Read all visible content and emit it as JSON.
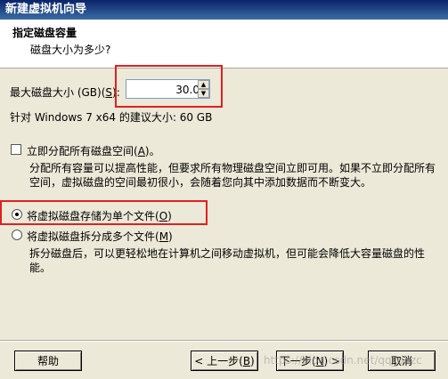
{
  "window": {
    "title": "新建虚拟机向导"
  },
  "header": {
    "title": "指定磁盘容量",
    "subtitle": "磁盘大小为多少?"
  },
  "disk_size": {
    "label_prefix": "最大磁盘大小 (GB)(",
    "label_hotkey": "S",
    "label_suffix": "):",
    "value": "30.0",
    "recommend": "针对 Windows 7 x64 的建议大小: 60 GB"
  },
  "allocate": {
    "label_prefix": "立即分配所有磁盘空间(",
    "label_hotkey": "A",
    "label_suffix": ")。",
    "checked": false,
    "desc_line1": "分配所有容量可以提高性能，但要求所有物理磁盘空间立即可用。如果不立即分配所有",
    "desc_line2": "空间，虚拟磁盘的空间最初很小，会随着您向其中添加数据而不断变大。"
  },
  "single_file": {
    "label_prefix": "将虚拟磁盘存储为单个文件(",
    "label_hotkey": "O",
    "label_suffix": ")",
    "selected": true
  },
  "multi_file": {
    "label_prefix": "将虚拟磁盘拆分成多个文件(",
    "label_hotkey": "M",
    "label_suffix": ")",
    "selected": false,
    "desc_line1": "拆分磁盘后，可以更轻松地在计算机之间移动虚拟机，但可能会降低大容量磁盘的性",
    "desc_line2": "能。"
  },
  "buttons": {
    "help": "帮助",
    "back_prefix": "< 上一步(",
    "back_hotkey": "B",
    "back_suffix": ")",
    "next_prefix": "下一步(",
    "next_hotkey": "N",
    "next_suffix": ") >",
    "cancel": "取消"
  },
  "watermark": "https://blog.csdn.net/qq_dhzc",
  "colors": {
    "highlight_box": "#e02020",
    "title_bar": "#0a246a"
  }
}
